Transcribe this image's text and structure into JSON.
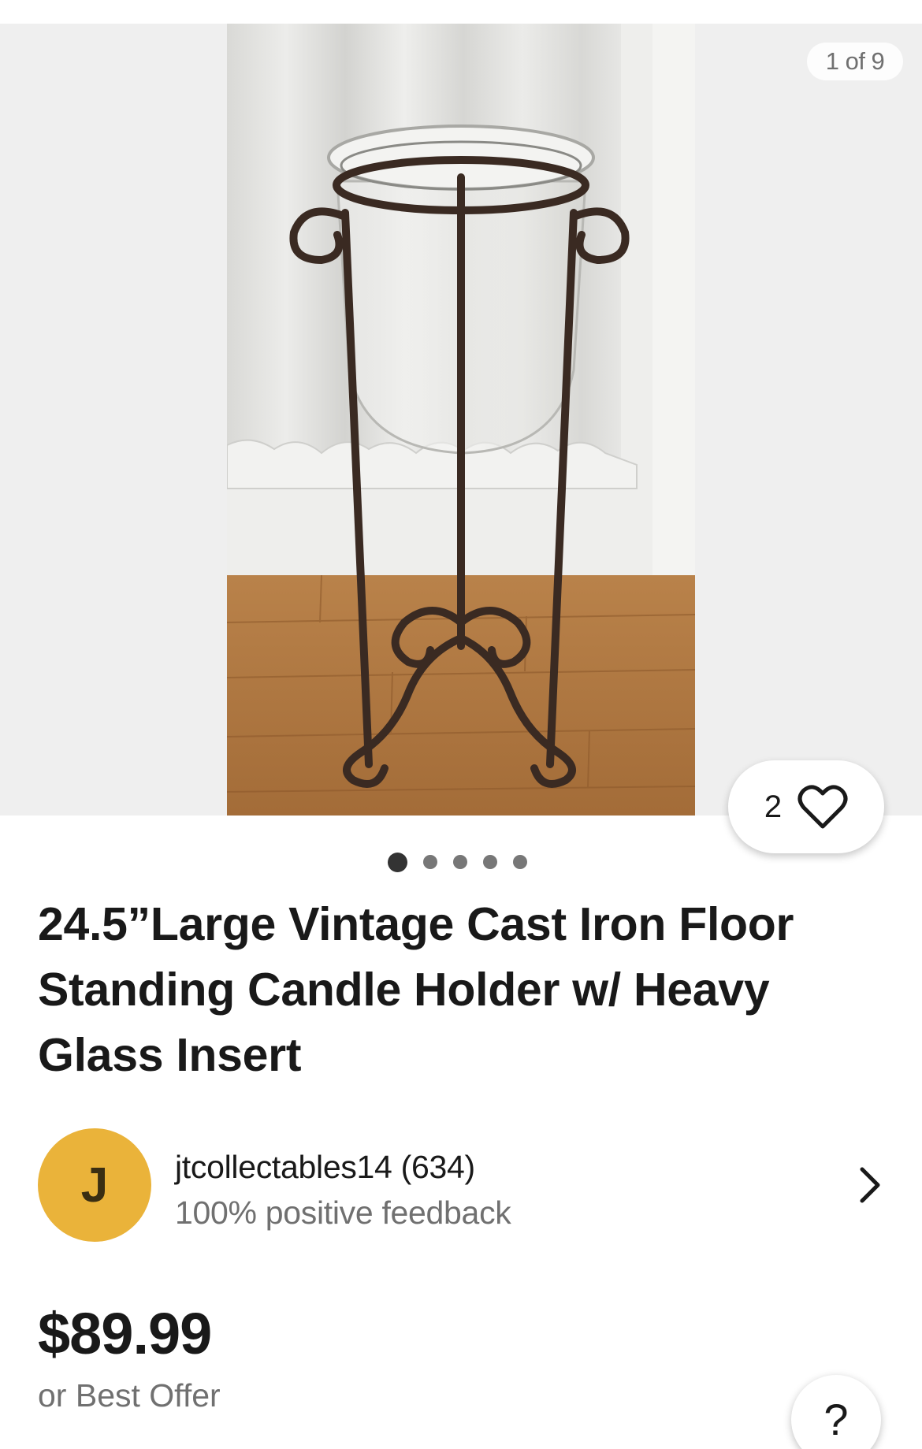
{
  "gallery": {
    "counter": "1 of 9",
    "image_alt": "Iron floor candle holder with glass insert",
    "total_dots": 5,
    "active_dot": 0
  },
  "watch": {
    "count": "2"
  },
  "listing": {
    "title": "24.5”Large Vintage Cast Iron Floor Standing Candle Holder w/ Heavy Glass Insert"
  },
  "seller": {
    "initial": "J",
    "name_with_score": "jtcollectables14 (634)",
    "feedback": "100% positive feedback"
  },
  "pricing": {
    "price": "$89.99",
    "offer_text": "or Best Offer"
  },
  "help": {
    "label": "?"
  },
  "colors": {
    "avatar": "#eab33a",
    "text_primary": "#191919",
    "text_secondary": "#707070",
    "gallery_bg": "#efefef"
  }
}
